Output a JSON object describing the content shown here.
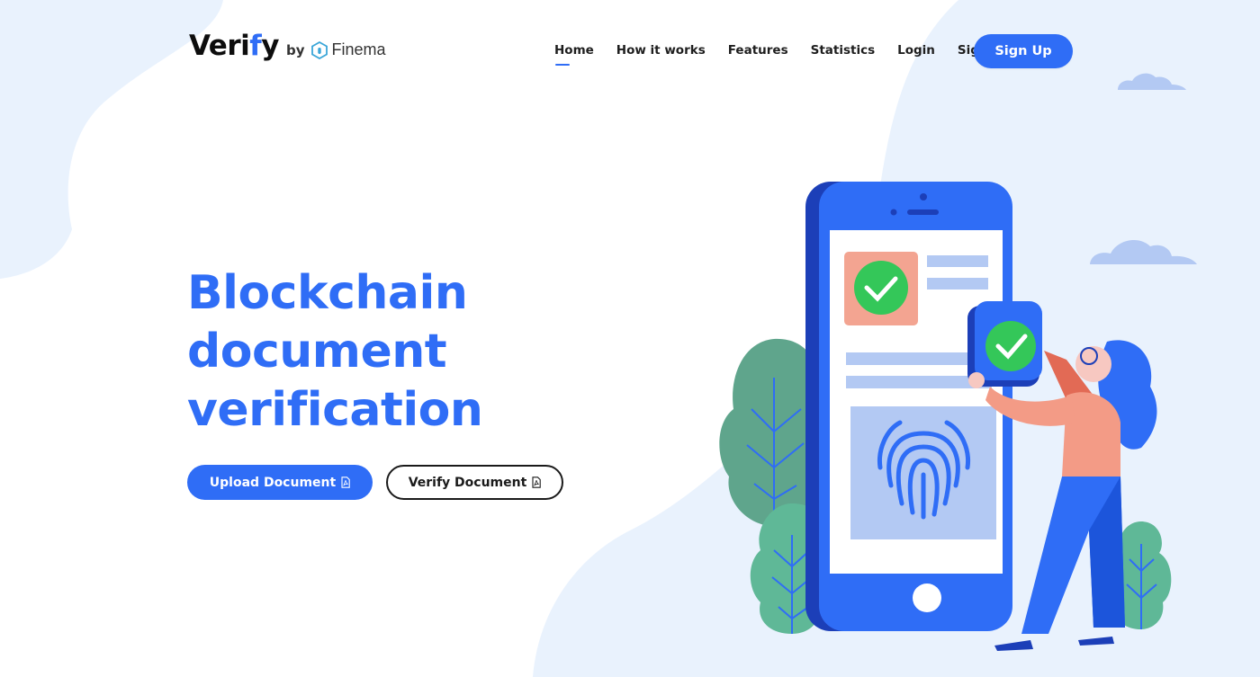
{
  "header": {
    "logo": {
      "word_start": "Veri",
      "word_accent": "f",
      "word_end": "y",
      "by": "by",
      "partner": "Finema"
    },
    "nav": [
      {
        "label": "Home",
        "active": true
      },
      {
        "label": "How it works",
        "active": false
      },
      {
        "label": "Features",
        "active": false
      },
      {
        "label": "Statistics",
        "active": false
      },
      {
        "label": "Login",
        "active": false
      },
      {
        "label": "Sign Up",
        "active": false
      }
    ],
    "cta_label": "Sign Up"
  },
  "hero": {
    "title_lines": [
      "Blockchain",
      "document",
      "verification"
    ],
    "upload_button": {
      "label": "Upload Document",
      "icon": "pdf-file-icon"
    },
    "verify_button": {
      "label": "Verify Document",
      "icon": "pdf-file-icon"
    }
  },
  "colors": {
    "brand_blue": "#2f6df6",
    "background_blob": "#e9f2fd",
    "cloud": "#b3c9f3",
    "check_green": "#34c759",
    "leaf_green": "#5fb897",
    "card_salmon": "#f3a491"
  },
  "illustration": {
    "icons": [
      "smartphone-icon",
      "checkmark-badge-icon",
      "fingerprint-icon",
      "shield-check-icon",
      "plant-icon",
      "cloud-icon",
      "person-icon"
    ]
  }
}
